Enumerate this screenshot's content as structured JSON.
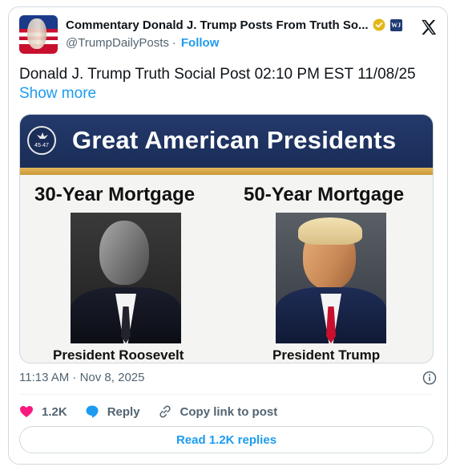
{
  "author": {
    "name": "Commentary Donald J. Trump Posts From Truth So...",
    "handle": "@TrumpDailyPosts",
    "separator": "·",
    "follow_label": "Follow",
    "affiliation_badge": "WJ"
  },
  "post": {
    "text": "Donald J. Trump Truth Social Post 02:10 PM EST 11/08/25",
    "show_more_label": "Show more"
  },
  "media": {
    "banner_title": "Great American Presidents",
    "seal_text": "45·47",
    "left_column": {
      "title": "30-Year Mortgage",
      "caption": "President Roosevelt"
    },
    "right_column": {
      "title": "50-Year Mortgage",
      "caption": "President Trump"
    }
  },
  "meta": {
    "timestamp": "11:13 AM · Nov 8, 2025"
  },
  "actions": {
    "like_count": "1.2K",
    "reply_label": "Reply",
    "copy_link_label": "Copy link to post"
  },
  "read_replies_label": "Read 1.2K replies",
  "colors": {
    "accent": "#1d9bf0",
    "like": "#f91880",
    "banner": "#1a2d58",
    "gold": "#d9a94a"
  },
  "icons": [
    "x-logo-icon",
    "verified-badge-icon",
    "info-icon",
    "heart-icon",
    "reply-bubble-icon",
    "link-icon"
  ]
}
